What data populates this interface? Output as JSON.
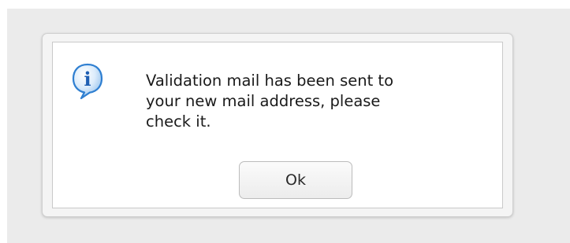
{
  "dialog": {
    "icon": "info-icon",
    "icon_glyph": "i",
    "message": "Validation mail has been sent to\nyour new mail address, please\ncheck it.",
    "ok_label": "Ok"
  },
  "colors": {
    "backdrop": "#ebebeb",
    "frame": "#f4f4f4",
    "body": "#ffffff",
    "icon_blue": "#2f7fd1",
    "text": "#1a1a1a"
  }
}
